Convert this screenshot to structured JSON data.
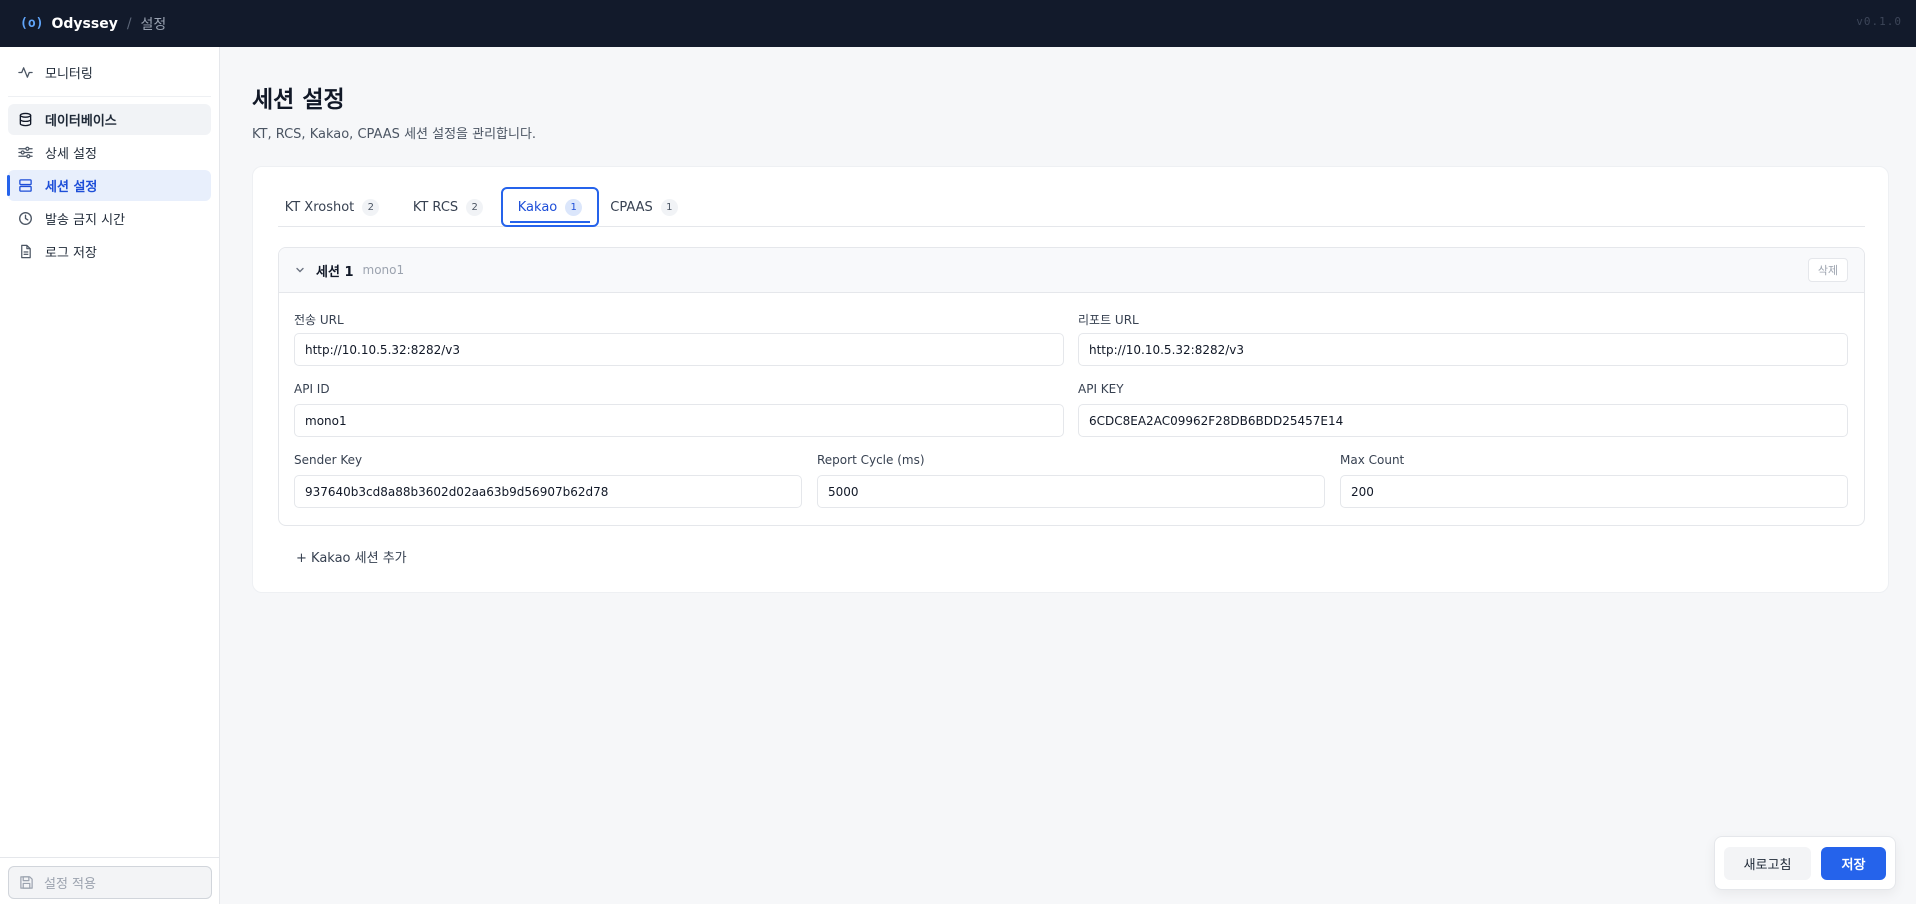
{
  "app": {
    "logo": "(o)",
    "name": "Odyssey",
    "separator": "/",
    "section": "설정",
    "version": "v0.1.0"
  },
  "sidebar": {
    "items": [
      {
        "label": "모니터링",
        "icon": "activity-icon",
        "state": "normal"
      },
      {
        "label": "데이터베이스",
        "icon": "database-icon",
        "state": "hover"
      },
      {
        "label": "상세 설정",
        "icon": "sliders-icon",
        "state": "normal"
      },
      {
        "label": "세션 설정",
        "icon": "server-icon",
        "state": "active"
      },
      {
        "label": "발송 금지 시간",
        "icon": "clock-icon",
        "state": "normal"
      },
      {
        "label": "로그 저장",
        "icon": "file-icon",
        "state": "normal"
      }
    ],
    "apply_button": "설정 적용"
  },
  "main": {
    "title": "세션 설정",
    "description": "KT, RCS, Kakao, CPAAS 세션 설정을 관리합니다.",
    "tabs": [
      {
        "label": "KT Xroshot",
        "count": "2"
      },
      {
        "label": "KT RCS",
        "count": "2"
      },
      {
        "label": "Kakao",
        "count": "1",
        "active": true
      },
      {
        "label": "CPAAS",
        "count": "1"
      }
    ],
    "session": {
      "name": "세션 1",
      "subtitle": "mono1",
      "delete_label": "삭제",
      "fields": {
        "send_url": {
          "label": "전송 URL",
          "value": "http://10.10.5.32:8282/v3"
        },
        "report_url": {
          "label": "리포트 URL",
          "value": "http://10.10.5.32:8282/v3"
        },
        "api_id": {
          "label": "API ID",
          "value": "mono1"
        },
        "api_key": {
          "label": "API KEY",
          "value": "6CDC8EA2AC09962F28DB6BDD25457E14"
        },
        "sender_key": {
          "label": "Sender Key",
          "value": "937640b3cd8a88b3602d02aa63b9d56907b62d78"
        },
        "report_cycle": {
          "label": "Report Cycle (ms)",
          "value": "5000"
        },
        "max_count": {
          "label": "Max Count",
          "value": "200"
        }
      }
    },
    "add_session": "+ Kakao 세션 추가"
  },
  "actions": {
    "refresh": "새로고침",
    "save": "저장"
  },
  "colors": {
    "accent": "#2563eb",
    "topbar": "#121a2b",
    "background": "#f6f7f9"
  }
}
